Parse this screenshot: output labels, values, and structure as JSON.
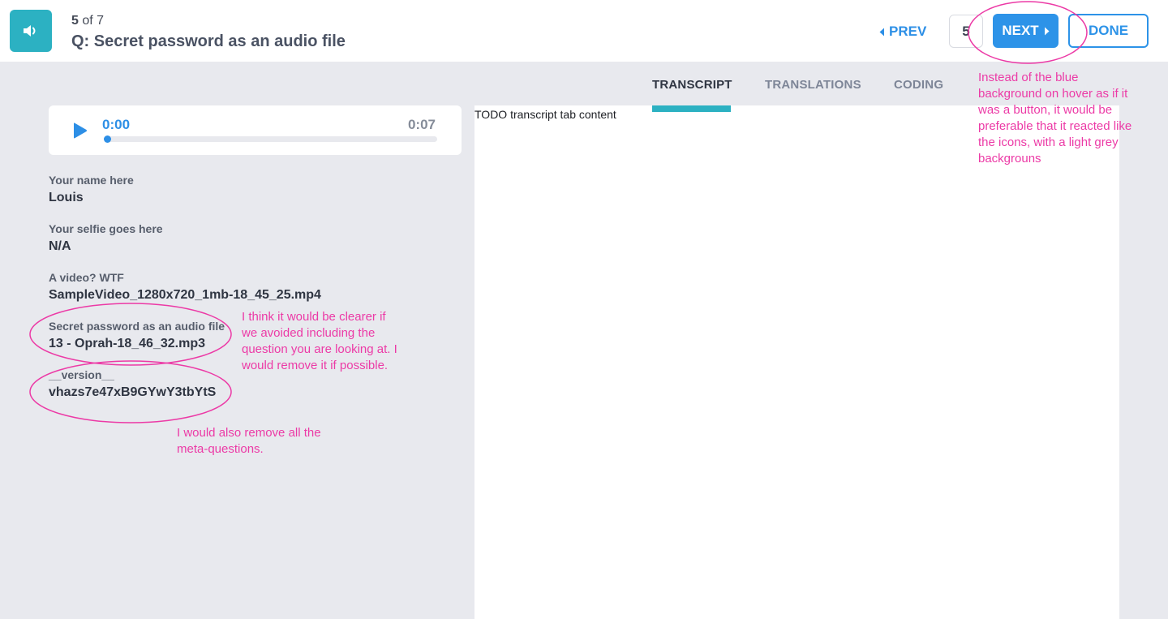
{
  "header": {
    "counter_current": "5",
    "counter_rest": " of 7",
    "question_title": "Q: Secret password as an audio file",
    "audio_icon": "speaker-icon",
    "prev_label": "PREV",
    "page_value": "5",
    "next_label": "NEXT",
    "done_label": "DONE",
    "accent_color": "#2d93e8",
    "badge_color": "#2cb1c2"
  },
  "player": {
    "current_time": "0:00",
    "total_time": "0:07",
    "progress_fraction": 0
  },
  "answers": [
    {
      "label": "Your name here",
      "value": "Louis"
    },
    {
      "label": "Your selfie goes here",
      "value": "N/A"
    },
    {
      "label": "A video? WTF",
      "value": "SampleVideo_1280x720_1mb-18_45_25.mp4"
    },
    {
      "label": "Secret password as an audio file",
      "value": "13 - Oprah-18_46_32.mp3"
    },
    {
      "label": "__version__",
      "value": "vhazs7e47xB9GYwY3tbYtS"
    }
  ],
  "tabs": {
    "transcript": "TRANSCRIPT",
    "translations": "TRANSLATIONS",
    "coding": "CODING",
    "active": "transcript"
  },
  "content": {
    "text": "TODO transcript tab content"
  },
  "annotations": {
    "color": "#ec3aa6",
    "hover_note_lines": [
      "Instead of the blue",
      "background on hover as if it",
      "was a button, it would be",
      "preferable that it reacted like",
      "the icons, with a light grey",
      "backgrouns"
    ],
    "question_note_lines": [
      "I think it would be clearer if",
      "we avoided including the",
      "question you are looking at. I",
      "would remove it if possible."
    ],
    "meta_note_lines": [
      "I would also remove all the",
      "meta-questions."
    ]
  }
}
